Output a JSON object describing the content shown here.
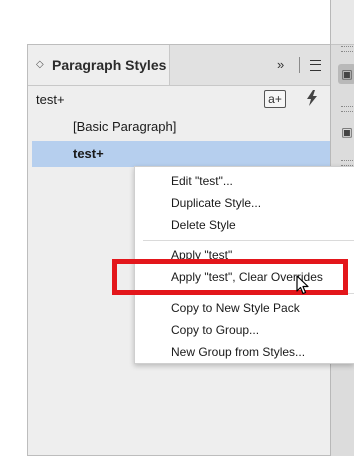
{
  "panel": {
    "title": "Paragraph Styles",
    "collapse_glyph": "◇",
    "expand_glyph": "»",
    "current_style": "test+",
    "new_style_icon": "a+",
    "clear_overrides_icon": "lightning-icon"
  },
  "styles": [
    {
      "label": "[Basic Paragraph]",
      "selected": false
    },
    {
      "label": "test+",
      "selected": true
    }
  ],
  "context_menu": {
    "group1": [
      "Edit \"test\"...",
      "Duplicate Style...",
      "Delete Style"
    ],
    "group2": [
      "Apply \"test\"",
      "Apply \"test\", Clear Overrides"
    ],
    "group3": [
      "Copy to New Style Pack",
      "Copy to Group...",
      "New Group from Styles..."
    ]
  },
  "colors": {
    "selection": "#b6cfee",
    "highlight": "#e3161b"
  }
}
